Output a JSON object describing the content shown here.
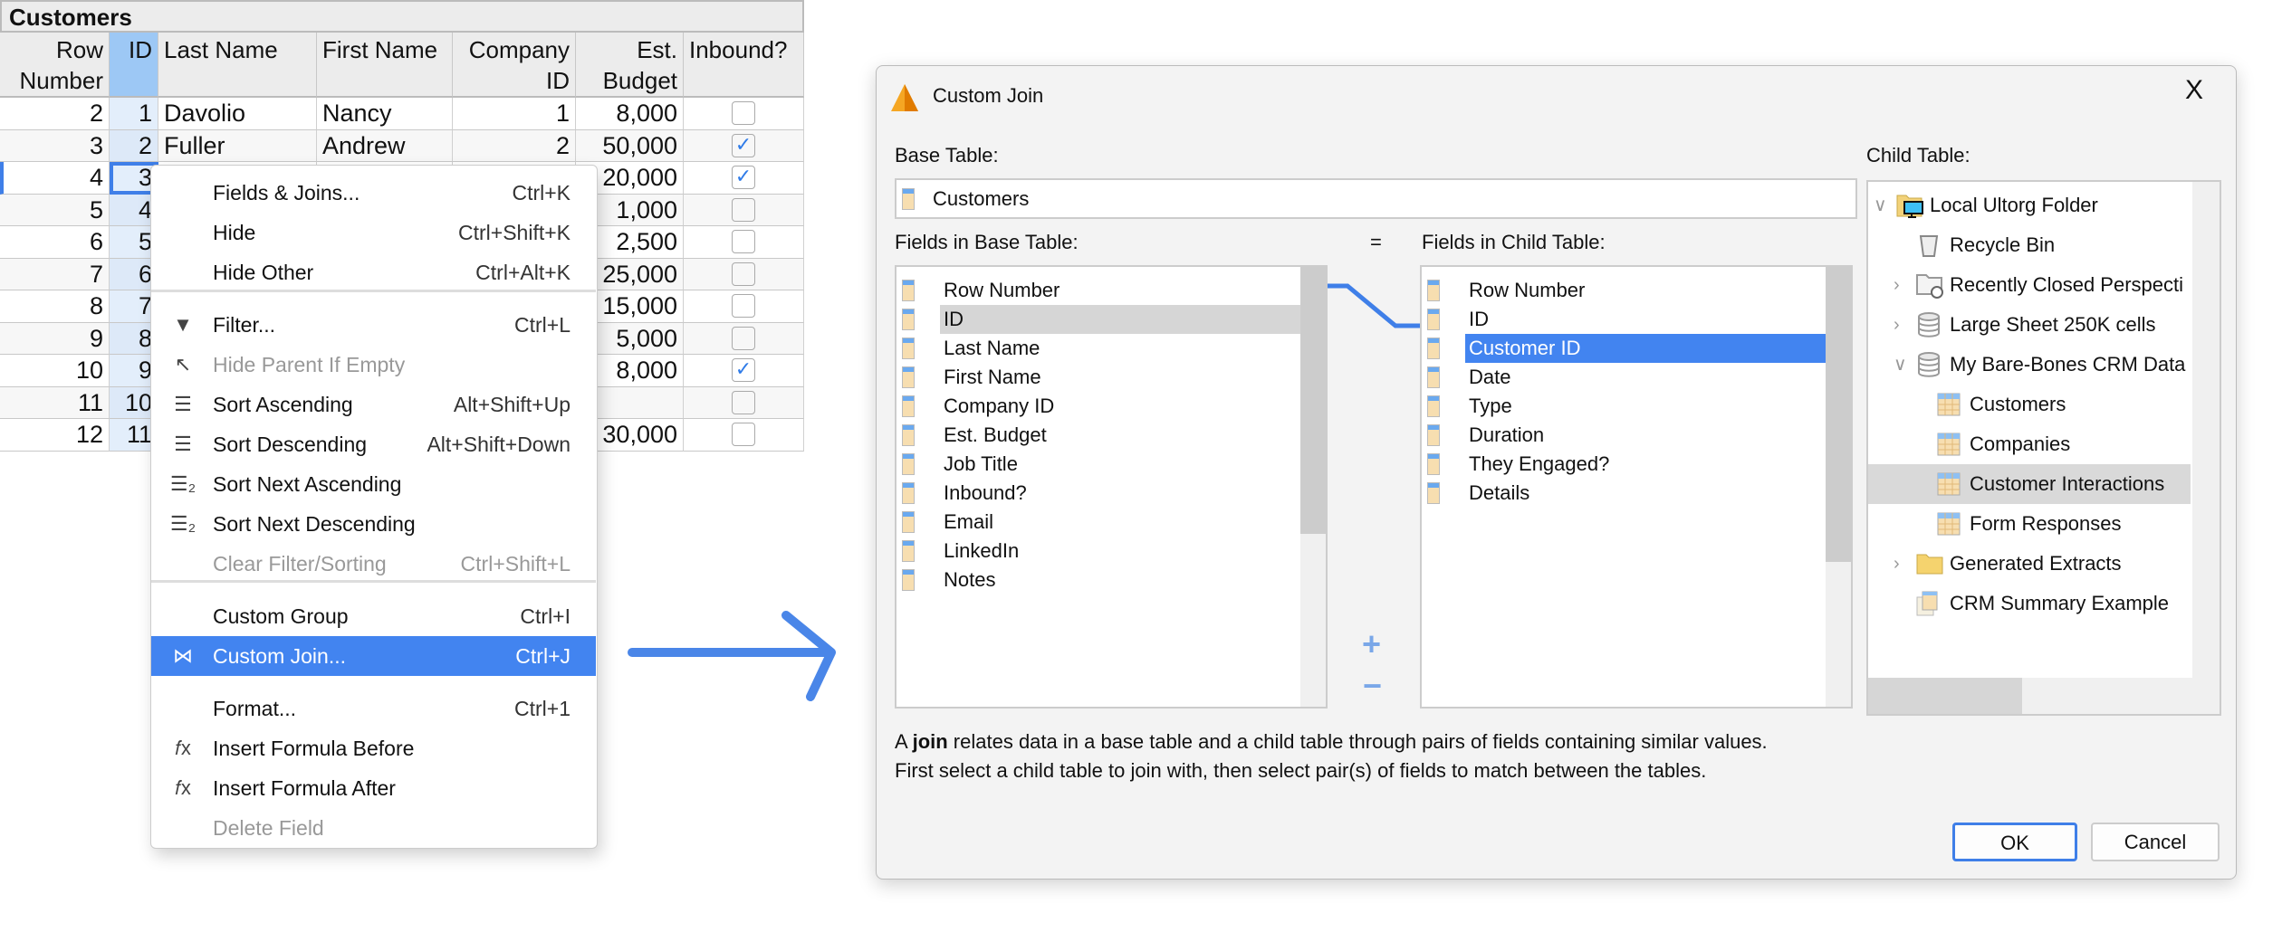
{
  "sheet": {
    "title": "Customers",
    "headers": [
      "Row Number",
      "ID",
      "Last Name",
      "First Name",
      "Company ID",
      "Est. Budget",
      "Inbound?"
    ],
    "rows": [
      [
        "2",
        "1",
        "Davolio",
        "Nancy",
        "1",
        "8,000",
        false
      ],
      [
        "3",
        "2",
        "Fuller",
        "Andrew",
        "2",
        "50,000",
        true
      ],
      [
        "4",
        "3",
        "",
        "",
        "",
        "20,000",
        true
      ],
      [
        "5",
        "4",
        "",
        "",
        "",
        "1,000",
        false
      ],
      [
        "6",
        "5",
        "",
        "",
        "",
        "2,500",
        false
      ],
      [
        "7",
        "6",
        "",
        "",
        "",
        "25,000",
        false
      ],
      [
        "8",
        "7",
        "",
        "",
        "",
        "15,000",
        false
      ],
      [
        "9",
        "8",
        "",
        "",
        "",
        "5,000",
        false
      ],
      [
        "10",
        "9",
        "",
        "",
        "",
        "8,000",
        true
      ],
      [
        "11",
        "10",
        "",
        "",
        "",
        "",
        false
      ],
      [
        "12",
        "11",
        "",
        "",
        "",
        "30,000",
        false
      ]
    ]
  },
  "menu": {
    "items": [
      {
        "label": "Fields & Joins...",
        "shortcut": "Ctrl+K",
        "icon": "",
        "disabled": false
      },
      {
        "label": "Hide",
        "shortcut": "Ctrl+Shift+K",
        "icon": "",
        "disabled": false
      },
      {
        "label": "Hide Other",
        "shortcut": "Ctrl+Alt+K",
        "icon": "",
        "disabled": false
      },
      {
        "label": "Filter...",
        "shortcut": "Ctrl+L",
        "icon": "filter-icon",
        "disabled": false
      },
      {
        "label": "Hide Parent If Empty",
        "shortcut": "",
        "icon": "arrow-up-left-icon",
        "disabled": true
      },
      {
        "label": "Sort Ascending",
        "shortcut": "Alt+Shift+Up",
        "icon": "sort-ascending-icon",
        "disabled": false
      },
      {
        "label": "Sort Descending",
        "shortcut": "Alt+Shift+Down",
        "icon": "sort-descending-icon",
        "disabled": false
      },
      {
        "label": "Sort Next Ascending",
        "shortcut": "",
        "icon": "sort-next-ascending-icon",
        "disabled": false
      },
      {
        "label": "Sort Next Descending",
        "shortcut": "",
        "icon": "sort-next-descending-icon",
        "disabled": false
      },
      {
        "label": "Clear Filter/Sorting",
        "shortcut": "Ctrl+Shift+L",
        "icon": "",
        "disabled": true
      },
      {
        "label": "Custom Group",
        "shortcut": "Ctrl+I",
        "icon": "",
        "disabled": false
      },
      {
        "label": "Custom Join...",
        "shortcut": "Ctrl+J",
        "icon": "join-icon",
        "disabled": false,
        "selected": true
      },
      {
        "label": "Format...",
        "shortcut": "Ctrl+1",
        "icon": "",
        "disabled": false
      },
      {
        "label": "Insert Formula Before",
        "shortcut": "",
        "icon": "fx-icon",
        "disabled": false
      },
      {
        "label": "Insert Formula After",
        "shortcut": "",
        "icon": "fx-icon",
        "disabled": false
      },
      {
        "label": "Delete Field",
        "shortcut": "",
        "icon": "",
        "disabled": true
      }
    ]
  },
  "dialog": {
    "title": "Custom Join",
    "close": "X",
    "base_table_label": "Base Table:",
    "base_table_value": "Customers",
    "base_fields_label": "Fields in Base Table:",
    "equals": "=",
    "child_fields_label": "Fields in Child Table:",
    "child_table_label": "Child Table:",
    "base_fields": [
      "Row Number",
      "ID",
      "Last Name",
      "First Name",
      "Company ID",
      "Est. Budget",
      "Job Title",
      "Inbound?",
      "Email",
      "LinkedIn",
      "Notes"
    ],
    "base_selected": "ID",
    "child_fields": [
      "Row Number",
      "ID",
      "Customer ID",
      "Date",
      "Type",
      "Duration",
      "They Engaged?",
      "Details"
    ],
    "child_selected": "Customer ID",
    "add": "+",
    "remove": "−",
    "tree": [
      {
        "label": "Local Ultorg Folder",
        "level": 0,
        "expander": "expanded",
        "icon": "computer-folder-icon"
      },
      {
        "label": "Recycle Bin",
        "level": 1,
        "expander": "",
        "icon": "recycle-bin-icon"
      },
      {
        "label": "Recently Closed Perspecti",
        "level": 1,
        "expander": "collapsed",
        "icon": "recent-folder-icon"
      },
      {
        "label": "Large Sheet 250K cells",
        "level": 1,
        "expander": "collapsed",
        "icon": "database-icon"
      },
      {
        "label": "My Bare-Bones CRM Data",
        "level": 1,
        "expander": "expanded",
        "icon": "database-icon"
      },
      {
        "label": "Customers",
        "level": 2,
        "expander": "",
        "icon": "table-icon"
      },
      {
        "label": "Companies",
        "level": 2,
        "expander": "",
        "icon": "table-icon"
      },
      {
        "label": "Customer Interactions",
        "level": 2,
        "expander": "",
        "icon": "table-icon",
        "selected": true
      },
      {
        "label": "Form Responses",
        "level": 2,
        "expander": "",
        "icon": "table-icon"
      },
      {
        "label": "Generated Extracts",
        "level": 1,
        "expander": "collapsed",
        "icon": "folder-icon"
      },
      {
        "label": "CRM Summary Example",
        "level": 1,
        "expander": "",
        "icon": "perspective-icon"
      }
    ],
    "desc_a": "A ",
    "desc_bold": "join",
    "desc_b": " relates data in a base table and a child table through pairs of fields containing similar values.",
    "desc_line2": "First select a child table to join with, then select pair(s) of fields to match between the tables.",
    "ok": "OK",
    "cancel": "Cancel"
  },
  "colors": {
    "accent": "#4284f0",
    "id_header": "#9dc8f5",
    "id_cells": "#e3eefb",
    "tree_selected": "#d9d9d9"
  }
}
